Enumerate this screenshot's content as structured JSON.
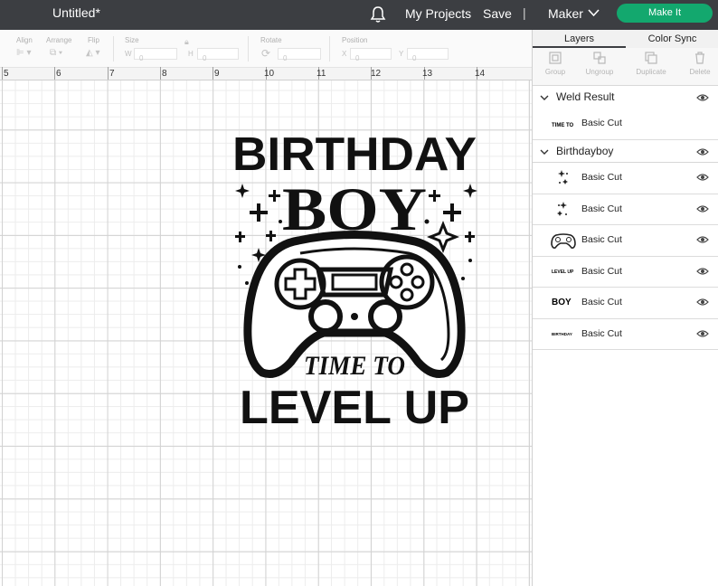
{
  "topbar": {
    "title": "Untitled*",
    "my_projects": "My Projects",
    "save": "Save",
    "separator": "|",
    "machine": "Maker",
    "make_it": "Make It",
    "make_it_color": "#13a86e",
    "bar_color": "#3c3e42"
  },
  "editbar": {
    "align": "Align",
    "arrange": "Arrange",
    "flip": "Flip",
    "size": "Size",
    "w": "W",
    "w_value": "0",
    "h": "H",
    "h_value": "0",
    "rotate": "Rotate",
    "rotate_value": "0",
    "position": "Position",
    "x": "X",
    "x_value": "0",
    "y": "Y",
    "y_value": "0"
  },
  "ruler": [
    "5",
    "6",
    "7",
    "8",
    "9",
    "10",
    "11",
    "12",
    "13",
    "14"
  ],
  "design": {
    "line1": "BIRTHDAY",
    "line2": "BOY",
    "line3": "TIME TO",
    "line4": "LEVEL UP"
  },
  "panel": {
    "tabs": [
      "Layers",
      "Color Sync"
    ],
    "tools": [
      "Group",
      "Ungroup",
      "Duplicate",
      "Delete"
    ],
    "groups": [
      {
        "name": "Weld Result",
        "layers": [
          {
            "thumb": "TIME TO",
            "label": "Basic Cut"
          }
        ]
      },
      {
        "name": "Birthdayboy",
        "layers": [
          {
            "thumb": "stars-icon",
            "label": "Basic Cut"
          },
          {
            "thumb": "stars-icon",
            "label": "Basic Cut"
          },
          {
            "thumb": "controller-icon",
            "label": "Basic Cut"
          },
          {
            "thumb": "LEVEL UP",
            "label": "Basic Cut"
          },
          {
            "thumb": "BOY",
            "label": "Basic Cut"
          },
          {
            "thumb": "BIRTHDAY",
            "label": "Basic Cut"
          }
        ]
      }
    ]
  }
}
